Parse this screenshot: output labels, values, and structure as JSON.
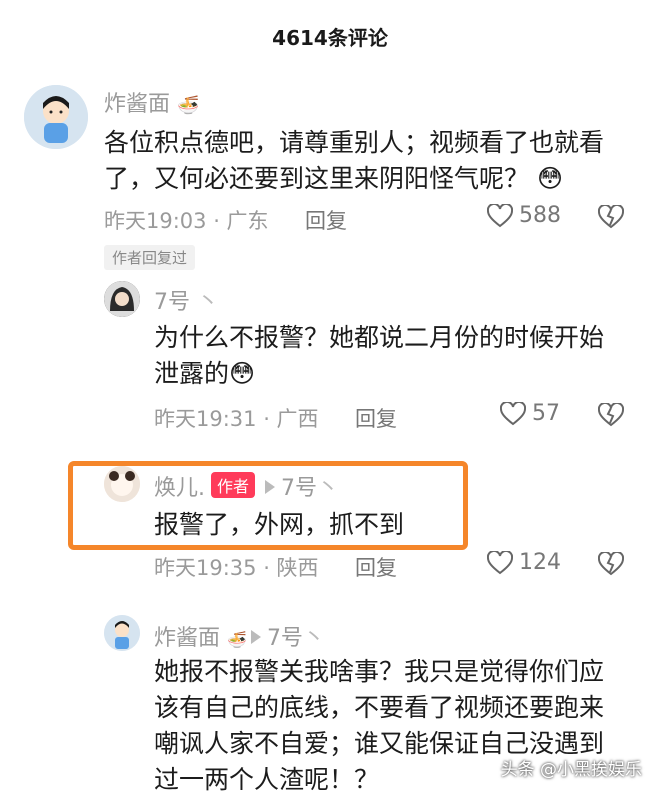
{
  "header": {
    "title": "4614条评论"
  },
  "comments": [
    {
      "user": "炸酱面",
      "text_line1": "各位积点德吧，请尊重别人；视频看了也就看",
      "text_line2": "了，又何必还要到这里来阴阳怪气呢？",
      "emoji": "😳",
      "time_location": "昨天19:03 · 广东",
      "reply_label": "回复",
      "likes": "588",
      "author_replied_badge": "作者回复过"
    },
    {
      "user": "7号",
      "text_line1": "为什么不报警？她都说二月份的时候开始",
      "text_line2": "泄露的",
      "emoji": "😳",
      "time_location": "昨天19:31 · 广西",
      "reply_label": "回复",
      "likes": "57"
    },
    {
      "user": "焕儿.",
      "author_tag": "作者",
      "reply_to": "7号",
      "text": "报警了，外网，抓不到",
      "time_location": "昨天19:35 · 陕西",
      "reply_label": "回复",
      "likes": "124"
    },
    {
      "user": "炸酱面",
      "reply_to": "7号",
      "text_line1": "她报不报警关我啥事？我只是觉得你们应",
      "text_line2": "该有自己的底线，不要看了视频还要跑来",
      "text_line3": "嘲讽人家不自爱；谁又能保证自己没遇到",
      "text_line4": "过一两个人渣呢！？"
    }
  ],
  "watermark": "头条 @小黑挨娱乐",
  "colors": {
    "author_tag": "#ff3b5a",
    "highlight": "#f5862a"
  }
}
